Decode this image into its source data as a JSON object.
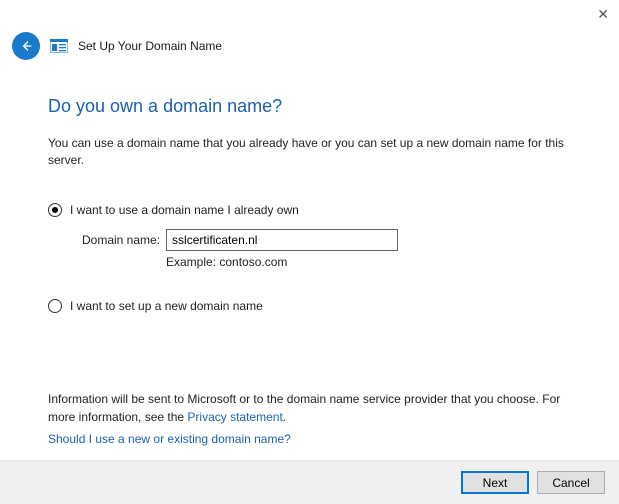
{
  "window": {
    "title": "Set Up Your Domain Name"
  },
  "heading": "Do you own a domain name?",
  "description": "You can use a domain name that you already have or you can set up a new domain name for this server.",
  "options": {
    "own": {
      "label": "I want to use a domain name I already own",
      "checked": true,
      "field_label": "Domain name:",
      "field_value": "sslcertificaten.nl",
      "example": "Example: contoso.com"
    },
    "new": {
      "label": "I want to set up a new domain name",
      "checked": false
    }
  },
  "info": {
    "line1": "Information will be sent to Microsoft or to the domain name service provider that you choose. For more information, see the ",
    "privacy_link": "Privacy statement",
    "period": ".",
    "help_link": "Should I use a new or existing domain name?"
  },
  "footer": {
    "next": "Next",
    "cancel": "Cancel"
  }
}
